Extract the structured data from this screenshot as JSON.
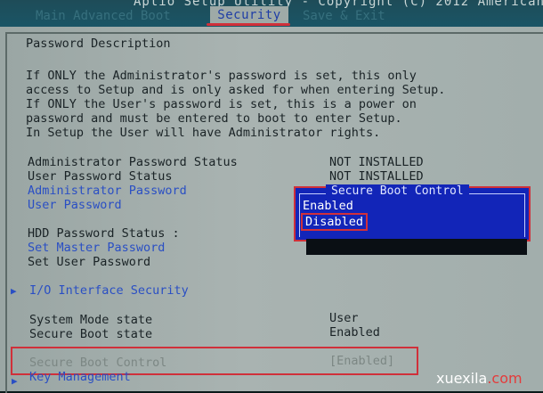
{
  "header": {
    "title": "Aptio Setup Utility - Copyright (C) 2012 American",
    "tabs_left": "Main  Advanced  Boot",
    "active_tab": "Security",
    "tabs_right": "Save & Exit"
  },
  "description": {
    "heading": "Password Description",
    "lines": [
      "If ONLY the Administrator's password is set, this only",
      "access to Setup and is only asked for when entering Setup.",
      "If ONLY the User's password is set, this is a power on",
      "password and must be entered to boot to enter Setup.",
      "In Setup the User will have Administrator rights."
    ]
  },
  "status": {
    "admin_label": "Administrator Password Status",
    "admin_value": "NOT INSTALLED",
    "user_label": "User Password Status",
    "user_value": "NOT INSTALLED"
  },
  "links": {
    "admin_password": "Administrator Password",
    "user_password": "User Password",
    "hdd_status": "HDD Password Status   :",
    "set_master": "Set Master Password",
    "set_user": "Set User Password",
    "io_security": "I/O Interface Security"
  },
  "mode": {
    "system_mode_label": "System Mode state",
    "system_mode_value": "User",
    "secure_boot_label": "Secure Boot state",
    "secure_boot_value": "Enabled",
    "secure_boot_control_label": "Secure Boot Control",
    "secure_boot_control_value": "[Enabled]",
    "key_management": "Key Management"
  },
  "popup": {
    "title": "Secure Boot Control",
    "options": [
      "Enabled",
      "Disabled"
    ],
    "selected": "Disabled"
  },
  "watermark": {
    "name": "xuexila",
    "tld": ".com"
  },
  "colors": {
    "background": "#a5b0ae",
    "link_blue": "#2a4fc4",
    "popup_blue": "#1225b8",
    "highlight_red": "#d0303a"
  }
}
